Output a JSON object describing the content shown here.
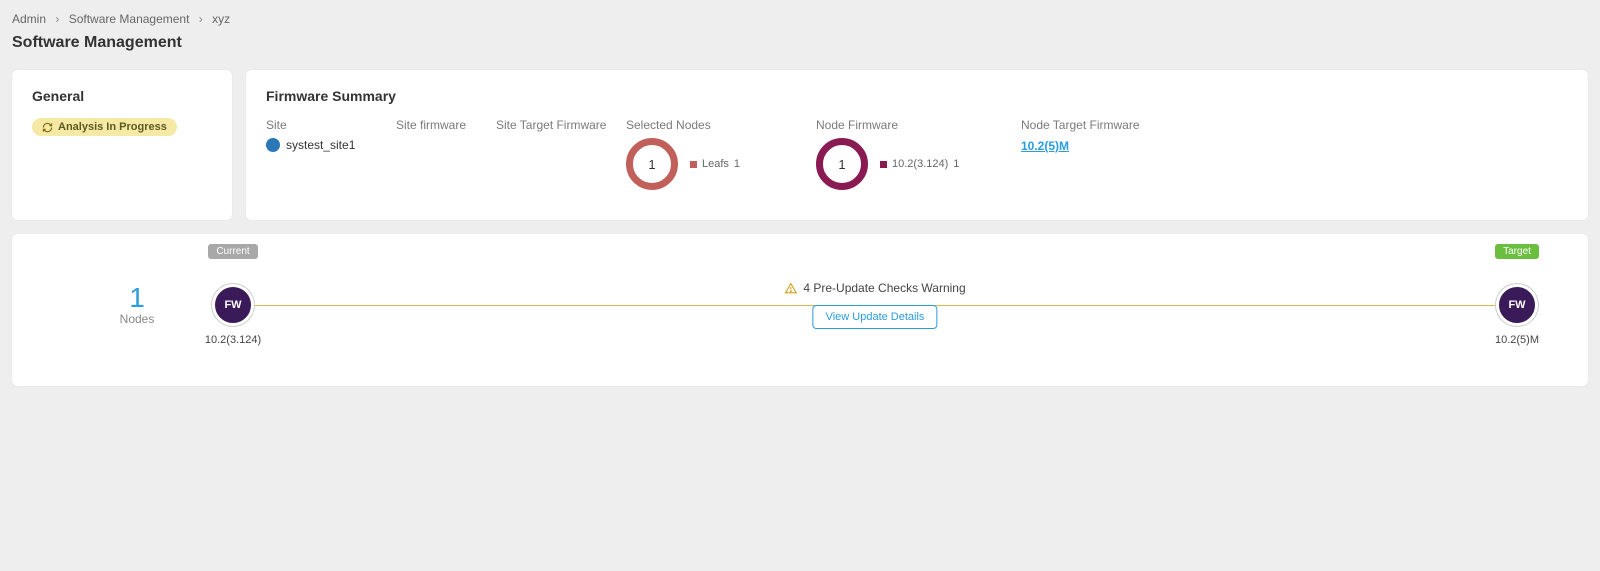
{
  "breadcrumb": {
    "a": "Admin",
    "b": "Software Management",
    "c": "xyz"
  },
  "page_title": "Software Management",
  "general": {
    "title": "General",
    "status": "Analysis In Progress"
  },
  "firmware": {
    "title": "Firmware Summary",
    "labels": {
      "site": "Site",
      "site_fw": "Site firmware",
      "site_target": "Site Target Firmware",
      "selected": "Selected Nodes",
      "node_fw": "Node Firmware",
      "node_target": "Node Target Firmware"
    },
    "site_value": "systest_site1",
    "selected_count": "1",
    "selected_legend_label": "Leafs",
    "selected_legend_count": "1",
    "nodefw_count": "1",
    "nodefw_legend_label": "10.2(3.124)",
    "nodefw_legend_count": "1",
    "node_target_value": "10.2(5)M"
  },
  "chart_data": [
    {
      "type": "pie",
      "title": "Selected Nodes",
      "series": [
        {
          "name": "Leafs",
          "value": 1
        }
      ],
      "total": 1
    },
    {
      "type": "pie",
      "title": "Node Firmware",
      "series": [
        {
          "name": "10.2(3.124)",
          "value": 1
        }
      ],
      "total": 1
    }
  ],
  "progress": {
    "nodes_count": "1",
    "nodes_label": "Nodes",
    "current_badge": "Current",
    "target_badge": "Target",
    "fw_text": "FW",
    "current_version": "10.2(3.124)",
    "target_version": "10.2(5)M",
    "warning_text": "4 Pre-Update Checks Warning",
    "view_button": "View Update Details"
  }
}
